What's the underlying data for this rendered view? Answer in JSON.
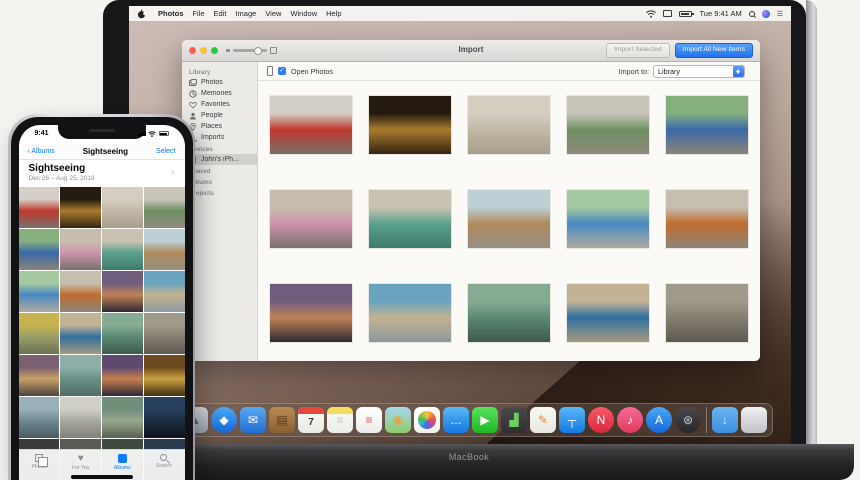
{
  "menu_bar": {
    "items": [
      "Photos",
      "File",
      "Edit",
      "Image",
      "View",
      "Window",
      "Help"
    ],
    "time": "Tue 9:41 AM",
    "status_icons": [
      "wifi-icon",
      "display-mirroring-icon",
      "battery-icon",
      "search-icon",
      "siri-icon",
      "notification-center-icon"
    ]
  },
  "window": {
    "title": "Import",
    "titlebar": {
      "import_selected_label": "Import Selected",
      "import_all_label": "Import All New Items"
    },
    "toolbar": {
      "open_photos_label": "Open Photos",
      "open_photos_checked": true,
      "import_to_label": "Import to:",
      "destination_value": "Library"
    },
    "sidebar": {
      "library_header": "Library",
      "library_items": [
        "Photos",
        "Memories",
        "Favorites",
        "People",
        "Places",
        "Imports"
      ],
      "devices_header": "Devices",
      "device_name": "John's iPh...",
      "shared_header": "Shared",
      "albums_header": "Albums",
      "projects_header": "Projects"
    },
    "grid_photos": [
      {
        "name": "photo-red-classic-car",
        "colors": [
          "#d3cfc6",
          "#c0392f",
          "#77706a"
        ]
      },
      {
        "name": "photo-night-building-lights",
        "colors": [
          "#241a10",
          "#a97b2f",
          "#352412"
        ]
      },
      {
        "name": "photo-white-facade-door",
        "colors": [
          "#d5cec0",
          "#c2b8a6",
          "#a89e8c"
        ]
      },
      {
        "name": "photo-green-classic-car",
        "colors": [
          "#c9c5ba",
          "#6e8f63",
          "#8f897c"
        ]
      },
      {
        "name": "photo-green-building-blue-car",
        "colors": [
          "#85b07e",
          "#3a68a8",
          "#8a8577"
        ]
      },
      {
        "name": "photo-ornate-building-pink-car",
        "colors": [
          "#c6bdae",
          "#cf93ae",
          "#76716a"
        ]
      },
      {
        "name": "photo-teal-colonial-arches",
        "colors": [
          "#c9c2b0",
          "#5aa18e",
          "#3f7a6a"
        ]
      },
      {
        "name": "photo-horse-cart-street",
        "colors": [
          "#bcd0d6",
          "#b08a5c",
          "#968f83"
        ]
      },
      {
        "name": "photo-green-house-blue-car",
        "colors": [
          "#a5c9a0",
          "#4789c2",
          "#b0ab9f"
        ]
      },
      {
        "name": "photo-orange-classic-car",
        "colors": [
          "#c6bfb0",
          "#c06b30",
          "#8c8679"
        ]
      },
      {
        "name": "photo-sunset-seascape",
        "colors": [
          "#6f5d7d",
          "#c08257",
          "#2e2933"
        ]
      },
      {
        "name": "photo-horse-rider-blue-wall",
        "colors": [
          "#6aa3bd",
          "#c3b291",
          "#8d9a9e"
        ]
      },
      {
        "name": "photo-green-balcony-detail",
        "colors": [
          "#86ab93",
          "#5b8871",
          "#3e5a4b"
        ]
      },
      {
        "name": "photo-street-blue-car",
        "colors": [
          "#c2b296",
          "#2f6f9e",
          "#a79a81"
        ]
      },
      {
        "name": "photo-narrow-alley",
        "colors": [
          "#a09a8d",
          "#847e72",
          "#5f5a50"
        ]
      }
    ]
  },
  "dock": {
    "icons": [
      {
        "name": "siri-icon",
        "shape": "circle",
        "c1": "#8b7be8",
        "c2": "#23233f",
        "glyph": "",
        "gc": "#fff"
      },
      {
        "name": "launchpad-icon",
        "shape": "square",
        "c1": "#d8dce2",
        "c2": "#9aa2ac",
        "glyph": "▲",
        "gc": "#5a6068"
      },
      {
        "name": "safari-icon",
        "shape": "circle",
        "c1": "#4aa9f5",
        "c2": "#1467d8",
        "glyph": "◆",
        "gc": "#f5f5f5"
      },
      {
        "name": "mail-icon",
        "shape": "square",
        "c1": "#5aa7f0",
        "c2": "#1e6fd0",
        "glyph": "✉",
        "gc": "#ffffff"
      },
      {
        "name": "contacts-icon",
        "shape": "square",
        "c1": "#b98b54",
        "c2": "#8a5f33",
        "glyph": "▤",
        "gc": "#5a3c1e"
      },
      {
        "name": "calendar-icon",
        "shape": "square",
        "c1": "#fafaf8",
        "c2": "#e8e8e4",
        "glyph": "7",
        "gc": "#333333"
      },
      {
        "name": "notes-icon",
        "shape": "square",
        "c1": "#fbfbf7",
        "c2": "#eeeee8",
        "glyph": "≡",
        "gc": "#c9c9c2"
      },
      {
        "name": "reminders-icon",
        "shape": "square",
        "c1": "#ffffff",
        "c2": "#ececec",
        "glyph": "≡",
        "gc": "#e05a4e"
      },
      {
        "name": "maps-icon",
        "shape": "square",
        "c1": "#a8d8f0",
        "c2": "#8fca6a",
        "glyph": "◉",
        "gc": "#e8a23c"
      },
      {
        "name": "photos-dock-icon",
        "shape": "square",
        "c1": "#ffffff",
        "c2": "#f0f0ec",
        "glyph": "",
        "gc": "#ffffff"
      },
      {
        "name": "messages-icon",
        "shape": "square",
        "c1": "#58b8f8",
        "c2": "#1478e0",
        "glyph": "…",
        "gc": "#ffffff"
      },
      {
        "name": "facetime-icon",
        "shape": "square",
        "c1": "#5ae05e",
        "c2": "#1fb824",
        "glyph": "▶",
        "gc": "#ffffff"
      },
      {
        "name": "numbers-icon",
        "shape": "square",
        "c1": "#4a4a4c",
        "c2": "#2e2e30",
        "glyph": "▟",
        "gc": "#6ad05e"
      },
      {
        "name": "pages-icon",
        "shape": "square",
        "c1": "#f8f8f4",
        "c2": "#e8e8e2",
        "glyph": "✎",
        "gc": "#e8862c"
      },
      {
        "name": "keynote-icon",
        "shape": "square",
        "c1": "#58b8f8",
        "c2": "#1478e0",
        "glyph": "┬",
        "gc": "#ffffff"
      },
      {
        "name": "news-icon",
        "shape": "circle",
        "c1": "#f85a6a",
        "c2": "#d8283c",
        "glyph": "N",
        "gc": "#ffffff"
      },
      {
        "name": "itunes-icon",
        "shape": "circle",
        "c1": "#f86a9a",
        "c2": "#e03c5a",
        "glyph": "♪",
        "gc": "#ffffff"
      },
      {
        "name": "app-store-icon",
        "shape": "circle",
        "c1": "#4aa9f5",
        "c2": "#1467d8",
        "glyph": "A",
        "gc": "#ffffff"
      },
      {
        "name": "system-preferences-icon",
        "shape": "circle",
        "c1": "#4a4a4e",
        "c2": "#28282c",
        "glyph": "⊛",
        "gc": "#c8c8cc"
      },
      {
        "name": "separator"
      },
      {
        "name": "downloads-folder-icon",
        "shape": "square",
        "c1": "#6ab4f0",
        "c2": "#3c8ee0",
        "glyph": "↓",
        "gc": "#eef6ff"
      },
      {
        "name": "trash-icon",
        "shape": "square",
        "c1": "#f0f0f2",
        "c2": "#c2c2c8",
        "glyph": "",
        "gc": "#fff"
      }
    ]
  },
  "macbook_label": "MacBook",
  "iphone": {
    "status_time": "9:41",
    "nav": {
      "back_label": "Albums",
      "title": "Sightseeing",
      "select_label": "Select"
    },
    "header": {
      "title": "Sightseeing",
      "date_range": "Dec 26 – Aug 25, 2018",
      "chevron": "›"
    },
    "tabs": [
      {
        "label": "Photos",
        "active": false
      },
      {
        "label": "For You",
        "active": false
      },
      {
        "label": "Albums",
        "active": true
      },
      {
        "label": "Search",
        "active": false
      }
    ],
    "grid_photos": [
      {
        "name": "photo-red-classic-car",
        "colors": [
          "#d3cfc6",
          "#c0392f",
          "#77706a"
        ]
      },
      {
        "name": "photo-night-building-lights",
        "colors": [
          "#241a10",
          "#a97b2f",
          "#352412"
        ]
      },
      {
        "name": "photo-white-facade-door",
        "colors": [
          "#d5cec0",
          "#c2b8a6",
          "#a89e8c"
        ]
      },
      {
        "name": "photo-green-classic-car",
        "colors": [
          "#c9c5ba",
          "#6e8f63",
          "#8f897c"
        ]
      },
      {
        "name": "photo-green-building-blue-car",
        "colors": [
          "#85b07e",
          "#3a68a8",
          "#8a8577"
        ]
      },
      {
        "name": "photo-ornate-building-pink-car",
        "colors": [
          "#c6bdae",
          "#cf93ae",
          "#76716a"
        ]
      },
      {
        "name": "photo-teal-colonial-arches",
        "colors": [
          "#c9c2b0",
          "#5aa18e",
          "#3f7a6a"
        ]
      },
      {
        "name": "photo-horse-cart-street",
        "colors": [
          "#bcd0d6",
          "#b08a5c",
          "#968f83"
        ]
      },
      {
        "name": "photo-green-house-blue-car",
        "colors": [
          "#a5c9a0",
          "#4789c2",
          "#b0ab9f"
        ]
      },
      {
        "name": "photo-orange-classic-car",
        "colors": [
          "#c6bfb0",
          "#c06b30",
          "#8c8679"
        ]
      },
      {
        "name": "photo-sunset-seascape",
        "colors": [
          "#6f5d7d",
          "#c08257",
          "#2e2933"
        ]
      },
      {
        "name": "photo-horse-on-beach",
        "colors": [
          "#6aa3bd",
          "#c3b291",
          "#8d9a9e"
        ]
      },
      {
        "name": "photo-yellow-alley",
        "colors": [
          "#c8b24f",
          "#9aa06a",
          "#6b7050"
        ]
      },
      {
        "name": "photo-street-blue-car",
        "colors": [
          "#c2b296",
          "#2f6f9e",
          "#a79a81"
        ]
      },
      {
        "name": "photo-green-balcony-detail",
        "colors": [
          "#86ab93",
          "#5b8871",
          "#3e5a4b"
        ]
      },
      {
        "name": "photo-narrow-alley",
        "colors": [
          "#a09a8d",
          "#847e72",
          "#5f5a50"
        ]
      },
      {
        "name": "photo-sunset-cliff",
        "colors": [
          "#7a6070",
          "#caa06a",
          "#4a4440"
        ]
      },
      {
        "name": "photo-coastal-view",
        "colors": [
          "#8fb0a8",
          "#6b8f86",
          "#4f6b62"
        ]
      },
      {
        "name": "photo-sunset-pier",
        "colors": [
          "#5e4a6e",
          "#c77f4e",
          "#30283a"
        ]
      },
      {
        "name": "photo-golden-lights",
        "colors": [
          "#6b4a1f",
          "#caa23f",
          "#3f2c12"
        ]
      },
      {
        "name": "photo-glass-dome",
        "colors": [
          "#9ab0b8",
          "#6f8890",
          "#4a5a60"
        ]
      },
      {
        "name": "photo-white-steps",
        "colors": [
          "#cfcfc8",
          "#a8a8a0",
          "#808078"
        ]
      },
      {
        "name": "photo-green-door-person",
        "colors": [
          "#6f8f78",
          "#9aa890",
          "#55604f"
        ]
      },
      {
        "name": "photo-dark-blue-scene",
        "colors": [
          "#27415e",
          "#1b2c40",
          "#10131d"
        ]
      },
      {
        "name": "photo-dark-street",
        "colors": [
          "#3a3a38",
          "#2c2c2a",
          "#1e1e1c"
        ]
      },
      {
        "name": "photo-dark-stairs",
        "colors": [
          "#5a5a54",
          "#3f3f3a",
          "#2a2a26"
        ]
      },
      {
        "name": "photo-dark-green",
        "colors": [
          "#3c4a3e",
          "#2c3a2e",
          "#1c261e"
        ]
      },
      {
        "name": "photo-dark-blue",
        "colors": [
          "#2c3a4e",
          "#1e2a3a",
          "#121a24"
        ]
      }
    ]
  },
  "colors": {
    "mac_accent_blue": "#2272ea",
    "ios_blue": "#0a7aff",
    "selection_gray": "#d2d0cc",
    "traffic_red": "#ff5f57",
    "traffic_yellow": "#febc2e",
    "traffic_green": "#28c840"
  }
}
